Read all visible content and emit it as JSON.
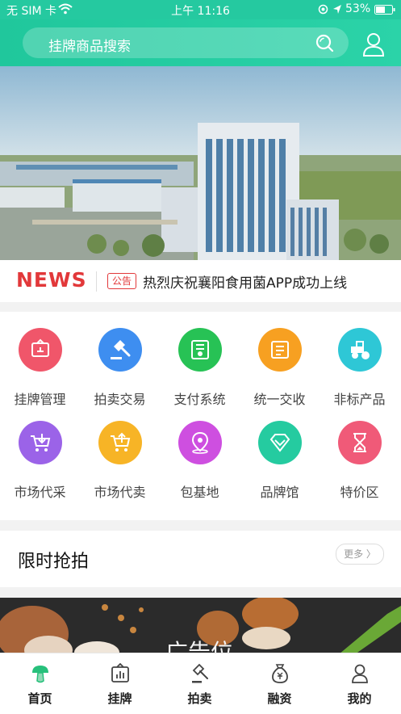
{
  "status": {
    "carrier": "无 SIM 卡",
    "time": "上午 11:16",
    "battery": "53%"
  },
  "header": {
    "search_placeholder": "挂牌商品搜索"
  },
  "news": {
    "logo": "NEWS",
    "badge": "公告",
    "text": "热烈庆祝襄阳食用菌APP成功上线"
  },
  "grid": {
    "items": [
      {
        "label": "挂牌管理",
        "color": "#f0566a"
      },
      {
        "label": "拍卖交易",
        "color": "#3e8ef0"
      },
      {
        "label": "支付系统",
        "color": "#27c255"
      },
      {
        "label": "统一交收",
        "color": "#f7a021"
      },
      {
        "label": "非标产品",
        "color": "#2ec7d6"
      },
      {
        "label": "市场代采",
        "color": "#9b63e8"
      },
      {
        "label": "市场代卖",
        "color": "#f7b426"
      },
      {
        "label": "包基地",
        "color": "#ce4fe0"
      },
      {
        "label": "品牌馆",
        "color": "#25cba0"
      },
      {
        "label": "特价区",
        "color": "#f05a78"
      }
    ]
  },
  "flash": {
    "title": "限时抢拍",
    "more": "更多 〉"
  },
  "ad": {
    "text": "广告位"
  },
  "tabs": [
    {
      "label": "首页",
      "icon": "mushroom-icon"
    },
    {
      "label": "挂牌",
      "icon": "chart-board-icon"
    },
    {
      "label": "拍卖",
      "icon": "gavel-icon"
    },
    {
      "label": "融资",
      "icon": "money-bag-icon"
    },
    {
      "label": "我的",
      "icon": "user-icon"
    }
  ]
}
